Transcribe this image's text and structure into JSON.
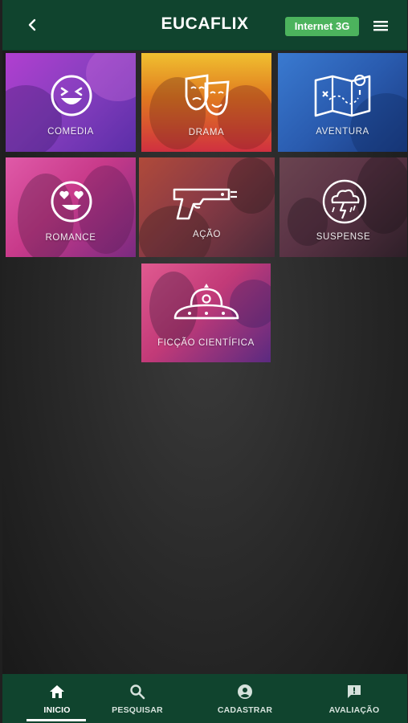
{
  "header": {
    "title": "EUCAFLIX",
    "network_badge": "Internet 3G",
    "back_icon": "chevron-left-icon",
    "menu_icon": "hamburger-menu-icon"
  },
  "categories": [
    {
      "label": "COMEDIA",
      "icon": "laughing-face-icon"
    },
    {
      "label": "DRAMA",
      "icon": "theater-masks-icon"
    },
    {
      "label": "AVENTURA",
      "icon": "treasure-map-icon"
    },
    {
      "label": "ROMANCE",
      "icon": "heart-eyes-face-icon"
    },
    {
      "label": "AÇÃO",
      "icon": "pistol-icon"
    },
    {
      "label": "SUSPENSE",
      "icon": "thunder-cloud-icon"
    },
    {
      "label": "FICÇÃO CIENTÍFICA",
      "icon": "ufo-icon"
    }
  ],
  "bottom_nav": [
    {
      "label": "INICIO",
      "icon": "home-icon",
      "active": true
    },
    {
      "label": "PESQUISAR",
      "icon": "search-icon",
      "active": false
    },
    {
      "label": "CADASTRAR",
      "icon": "account-circle-icon",
      "active": false
    },
    {
      "label": "AVALIAÇÃO",
      "icon": "feedback-icon",
      "active": false
    }
  ],
  "colors": {
    "header_bg": "#10442e",
    "badge_bg": "#4cb35d",
    "comedia": "#8a3fc0",
    "drama": "#e07a1f",
    "aventura": "#2a5cb0",
    "romance": "#c83a8a",
    "acao": "#8a3b45",
    "suspense": "#5a3345",
    "ficcao": "#c23a78"
  }
}
